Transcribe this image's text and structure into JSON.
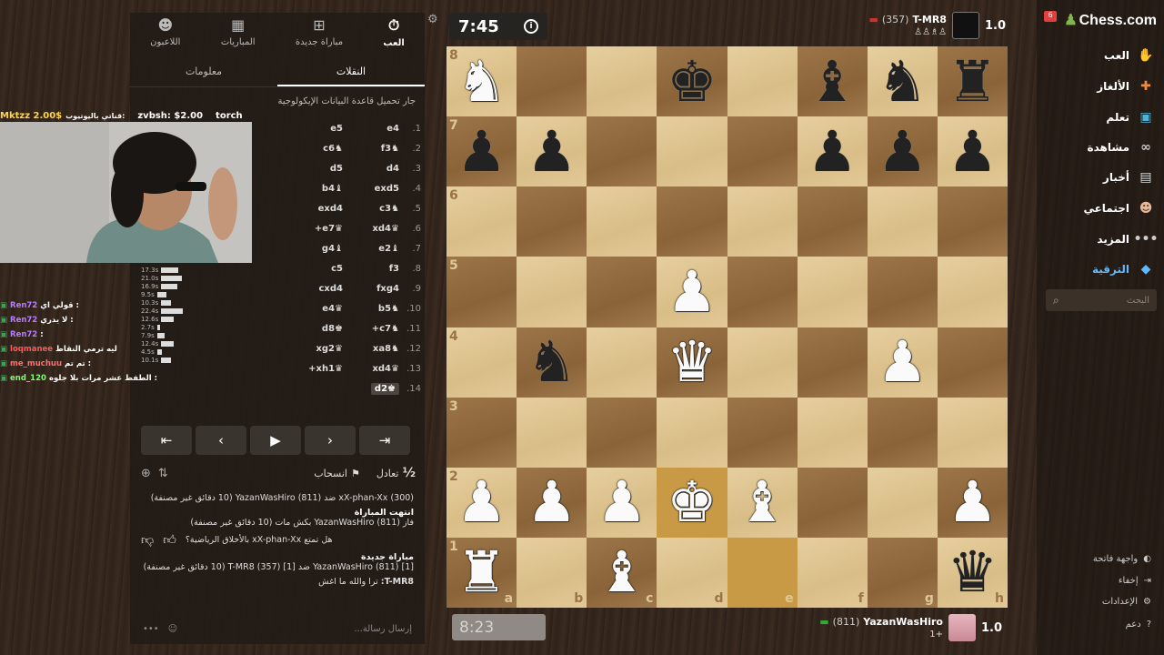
{
  "sidebar": {
    "logo": "Chess.com",
    "notification_count": "6",
    "items": [
      {
        "label": "العب",
        "icon": "play-hand-icon"
      },
      {
        "label": "الألغاز",
        "icon": "puzzle-icon"
      },
      {
        "label": "تعلم",
        "icon": "learn-icon"
      },
      {
        "label": "مشاهدة",
        "icon": "binoculars-icon"
      },
      {
        "label": "أخبار",
        "icon": "news-icon"
      },
      {
        "label": "اجتماعي",
        "icon": "social-icon"
      },
      {
        "label": "المزيد",
        "icon": "more-dots-icon"
      },
      {
        "label": "الترقية",
        "icon": "diamond-icon"
      }
    ],
    "search_placeholder": "البحث",
    "bottom": [
      {
        "label": "واجهة فاتحة",
        "icon": "contrast-icon"
      },
      {
        "label": "إخفاء",
        "icon": "collapse-icon"
      },
      {
        "label": "الإعدادات",
        "icon": "settings-gear-icon"
      },
      {
        "label": "دعم",
        "icon": "help-icon"
      }
    ]
  },
  "top_player": {
    "name": "T-MR8",
    "rating": "(357)",
    "score": "1.0",
    "clock": "7:45"
  },
  "bottom_player": {
    "name": "YazanWasHiro",
    "rating": "(811)",
    "score": "1.0",
    "clock": "8:23",
    "extra": "+1"
  },
  "panel": {
    "nav": [
      {
        "label": "العب",
        "icon": "clock-icon"
      },
      {
        "label": "مباراة جديدة",
        "icon": "plus-icon"
      },
      {
        "label": "المباريات",
        "icon": "board-icon"
      },
      {
        "label": "اللاعبون",
        "icon": "players-icon"
      }
    ],
    "tabs": [
      "النقلات",
      "معلومات"
    ],
    "opening_text": "جار تحميل قاعدة البيانات الإيكولوجية",
    "moves": [
      {
        "n": "1.",
        "w": "e4",
        "b": "e5"
      },
      {
        "n": "2.",
        "w": "♞f3",
        "b": "♞c6"
      },
      {
        "n": "3.",
        "w": "d4",
        "b": "d5"
      },
      {
        "n": "4.",
        "w": "exd5",
        "b": "♝b4"
      },
      {
        "n": "5.",
        "w": "♞c3",
        "b": "exd4"
      },
      {
        "n": "6.",
        "w": "♛xd4",
        "b": "♛e7+"
      },
      {
        "n": "7.",
        "w": "♝e2",
        "b": "♝g4"
      },
      {
        "n": "8.",
        "w": "f3",
        "b": "c5"
      },
      {
        "n": "9.",
        "w": "fxg4",
        "b": "cxd4"
      },
      {
        "n": "10.",
        "w": "♞b5",
        "b": "♛e4"
      },
      {
        "n": "11.",
        "w": "♞c7+",
        "b": "♚d8"
      },
      {
        "n": "12.",
        "w": "♞xa8",
        "b": "♛xg2"
      },
      {
        "n": "13.",
        "w": "♛xd4",
        "b": "♛xh1+"
      },
      {
        "n": "14.",
        "w": "♚d2",
        "b": ""
      }
    ],
    "draw_label": "تعادل",
    "draw_frac": "½",
    "resign_label": "انسحاب",
    "log": {
      "l1": "xX-phan-Xx (300) ضد YazanWasHiro (811) (10 دقائق غير مصنفة)",
      "l2h": "انتهت المباراة",
      "l2": "فاز YazanWasHiro (811) بكش مات (10 دقائق غير مصنفة)",
      "l3": "هل تمتع xX-phan-Xx بالأخلاق الرياضية؟",
      "l4h": "مباراة جديدة",
      "l4": "[1] YazanWasHiro (811) ضد [1] T-MR8 (357) (10 دقائق غير مصنفة)",
      "l5n": "T-MR8:",
      "l5": "ترا والله ما اغش"
    },
    "chat_placeholder": "إرسال رسالة..."
  },
  "stream": {
    "top_items": [
      "Mktzz 2.00$",
      "قناتي باليوتيوب:",
      "zvbsh: $2.00",
      "torch"
    ],
    "chat": [
      {
        "user": "Ren72",
        "msg": "قولي اي :"
      },
      {
        "user": "Ren72",
        "msg": "لا يدري :"
      },
      {
        "user": "Ren72",
        "msg": ":"
      },
      {
        "user": "loqmanee",
        "msg": "ليه ترمي النقاط"
      },
      {
        "user": "me_muchuu",
        "msg": "تم تم :"
      },
      {
        "user": "end_120",
        "msg": "الطفط عشر مرات بلا جلوه :"
      }
    ],
    "stat_values": [
      "17.3s",
      "21.0s",
      "16.9s",
      "9.5s",
      "10.3s",
      "22.4s",
      "12.6s",
      "2.7s",
      "7.9s",
      "12.4s",
      "4.5s",
      "10.1s"
    ]
  },
  "board": {
    "files": [
      "a",
      "b",
      "c",
      "d",
      "e",
      "f",
      "g",
      "h"
    ],
    "ranks": [
      "8",
      "7",
      "6",
      "5",
      "4",
      "3",
      "2",
      "1"
    ],
    "position": [
      [
        "wN",
        "",
        "",
        "bK",
        "",
        "bB",
        "bN",
        "bR"
      ],
      [
        "bP",
        "bP",
        "",
        "",
        "",
        "bP",
        "bP",
        "bP"
      ],
      [
        "",
        "",
        "",
        "",
        "",
        "",
        "",
        ""
      ],
      [
        "",
        "",
        "",
        "wP",
        "",
        "",
        "",
        ""
      ],
      [
        "",
        "bN",
        "",
        "wQ",
        "",
        "",
        "wP",
        ""
      ],
      [
        "",
        "",
        "",
        "",
        "",
        "",
        "",
        ""
      ],
      [
        "wP",
        "wP",
        "wP",
        "wK",
        "wB",
        "",
        "",
        "wP"
      ],
      [
        "wR",
        "",
        "wB",
        "",
        "",
        "",
        "",
        "bQ"
      ]
    ],
    "highlights": [
      "d2",
      "e1"
    ]
  }
}
